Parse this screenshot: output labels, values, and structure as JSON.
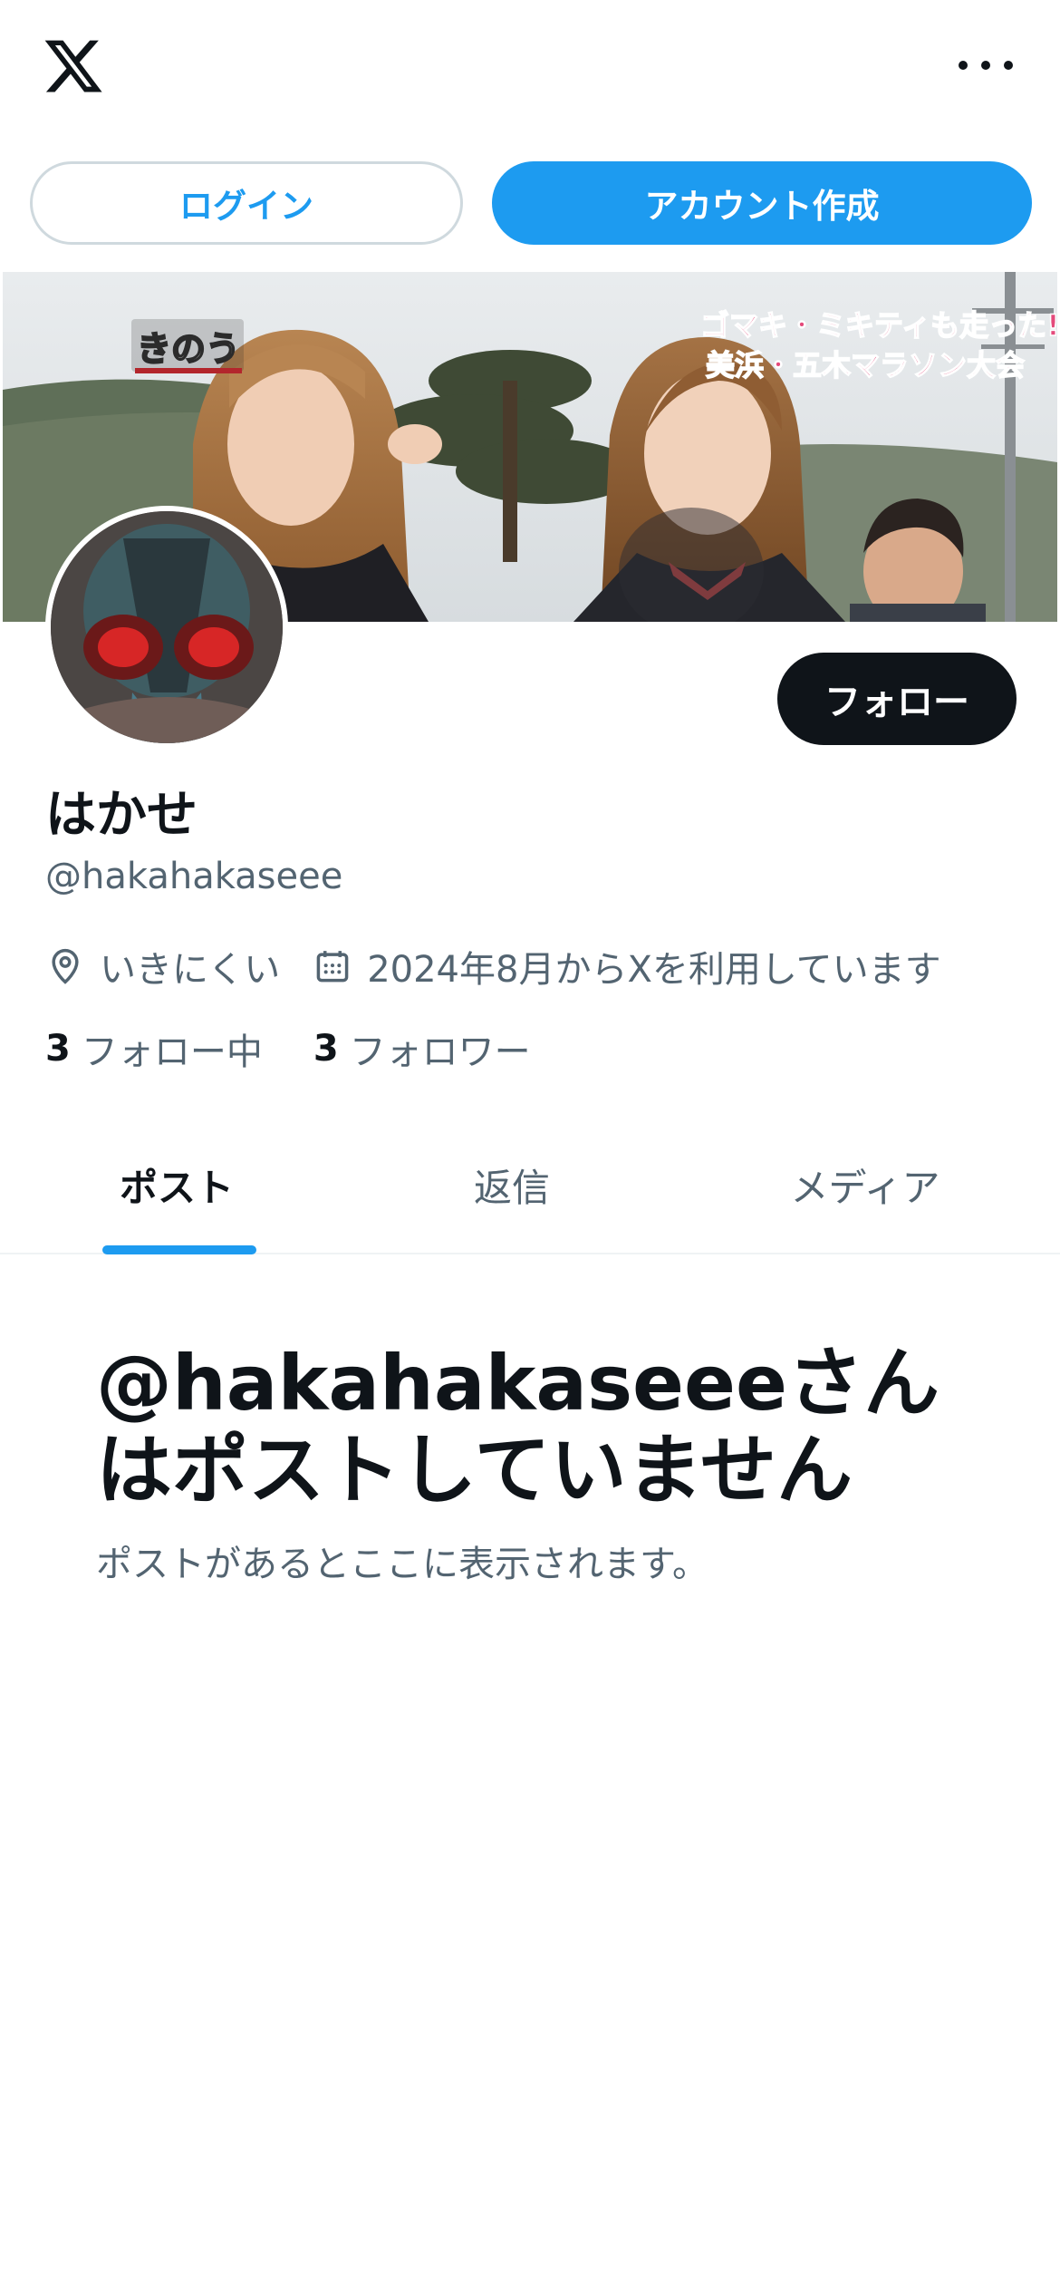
{
  "header": {
    "logo_icon": "x-logo-icon",
    "more_icon": "more-horizontal-icon"
  },
  "auth": {
    "login_label": "ログイン",
    "signup_label": "アカウント作成"
  },
  "banner": {
    "caption_left": "きのう",
    "caption_right_line1": "ゴマキ・ミキティも走った!",
    "caption_right_line2": "美浜・五木マラソン大会"
  },
  "profile": {
    "follow_label": "フォロー",
    "display_name": "はかせ",
    "handle": "@hakahakaseee",
    "location": "いきにくい",
    "joined": "2024年8月からXを利用しています",
    "following_count": "3",
    "following_label": "フォロー中",
    "followers_count": "3",
    "followers_label": "フォロワー"
  },
  "tabs": [
    {
      "label": "ポスト",
      "active": true
    },
    {
      "label": "返信",
      "active": false
    },
    {
      "label": "メディア",
      "active": false
    }
  ],
  "empty": {
    "title": "@hakahakaseeeさんはポストしていません",
    "subtitle": "ポストがあるとここに表示されます。"
  },
  "colors": {
    "accent": "#1d9bf0",
    "text_primary": "#0f1419",
    "text_secondary": "#536471",
    "border": "#cfd9de"
  }
}
